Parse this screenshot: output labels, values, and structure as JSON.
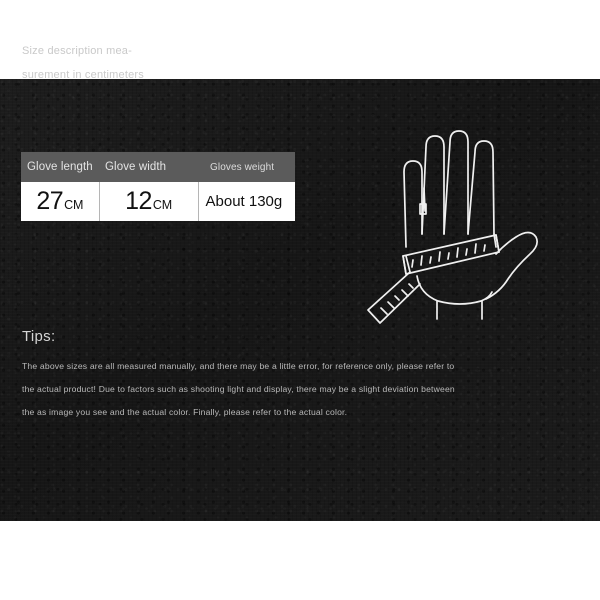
{
  "description": {
    "line1": "Size description mea-",
    "line2": "surement in centimeters"
  },
  "spec_table": {
    "headers": {
      "col1": "Glove length",
      "col2": "Glove width",
      "col3": "Gloves weight"
    },
    "values": {
      "glove_length_number": "27",
      "glove_length_unit": "CM",
      "glove_width_number": "12",
      "glove_width_unit": "CM",
      "gloves_weight": "About 130g"
    },
    "colors": {
      "header_background": "#5b5b5b",
      "header_text": "#e4e4e4",
      "body_background": "#ffffff",
      "body_text": "#111111"
    }
  },
  "illustration": {
    "name": "hand-with-measuring-tape",
    "stroke_color": "#f0f0f0"
  },
  "tips": {
    "heading": "Tips:",
    "line1": "The above sizes are all measured manually, and there may be a little error, for reference only, please refer to",
    "line2": "the actual product! Due to factors such as shooting light and display, there may be a slight deviation between",
    "line3": "the as image you see and the actual color. Finally, please refer to the actual color."
  },
  "theme": {
    "panel_background": "#191919",
    "page_background": "#ffffff",
    "body_text": "#b9b9b9",
    "heading_text": "#d4d4d4"
  }
}
